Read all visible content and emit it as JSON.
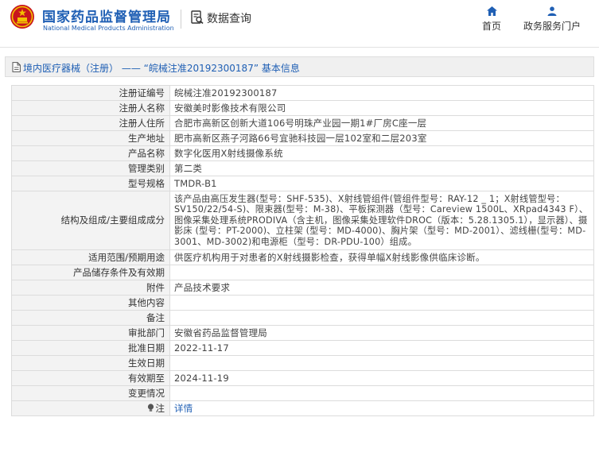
{
  "header": {
    "brand_cn": "国家药品监督管理局",
    "brand_en": "National Medical Products Administration",
    "data_query": "数据查询",
    "nav_home": "首页",
    "nav_portal": "政务服务门户"
  },
  "page": {
    "title": "境内医疗器械（注册） —— “皖械注准20192300187” 基本信息"
  },
  "rows": [
    {
      "label": "注册证编号",
      "value": "皖械注准20192300187"
    },
    {
      "label": "注册人名称",
      "value": "安徽美时影像技术有限公司"
    },
    {
      "label": "注册人住所",
      "value": "合肥市高新区创新大道106号明珠产业园一期1#厂房C座一层"
    },
    {
      "label": "生产地址",
      "value": "肥市高新区燕子河路66号宜驰科技园一层102室和二层203室"
    },
    {
      "label": "产品名称",
      "value": "数字化医用X射线摄像系统"
    },
    {
      "label": "管理类别",
      "value": "第二类"
    },
    {
      "label": "型号规格",
      "value": "TMDR-B1"
    },
    {
      "label": "结构及组成/主要组成成分",
      "value": "该产品由高压发生器(型号：SHF-535)、X射线管组件(管组件型号：RAY-12 _ 1；X射线管型号：SV150/22/54-S)、限束器(型号：M-38)、平板探测器（型号：Careview 1500L、XRpad4343 F）、图像采集处理系统PRODIVA（含主机，图像采集处理软件DROC（版本：5.28.1305.1），显示器）、摄影床 (型号：PT-2000)、立柱架 (型号：MD-4000)、胸片架（型号：MD-2001）、滤线栅(型号：MD-3001、MD-3002)和电源柜（型号：DR-PDU-100）组成。"
    },
    {
      "label": "适用范围/预期用途",
      "value": "供医疗机构用于对患者的X射线摄影检查，获得单幅X射线影像供临床诊断。"
    },
    {
      "label": "产品储存条件及有效期",
      "value": ""
    },
    {
      "label": "附件",
      "value": "产品技术要求"
    },
    {
      "label": "其他内容",
      "value": ""
    },
    {
      "label": "备注",
      "value": ""
    },
    {
      "label": "审批部门",
      "value": "安徽省药品监督管理局"
    },
    {
      "label": "批准日期",
      "value": "2022-11-17"
    },
    {
      "label": "生效日期",
      "value": ""
    },
    {
      "label": "有效期至",
      "value": "2024-11-19"
    },
    {
      "label": "变更情况",
      "value": ""
    }
  ],
  "note_row": {
    "label": "注",
    "link": "详情"
  },
  "colors": {
    "brand_blue": "#1f5fb4",
    "emblem_red": "#c8161d",
    "emblem_gold": "#f2c200"
  }
}
